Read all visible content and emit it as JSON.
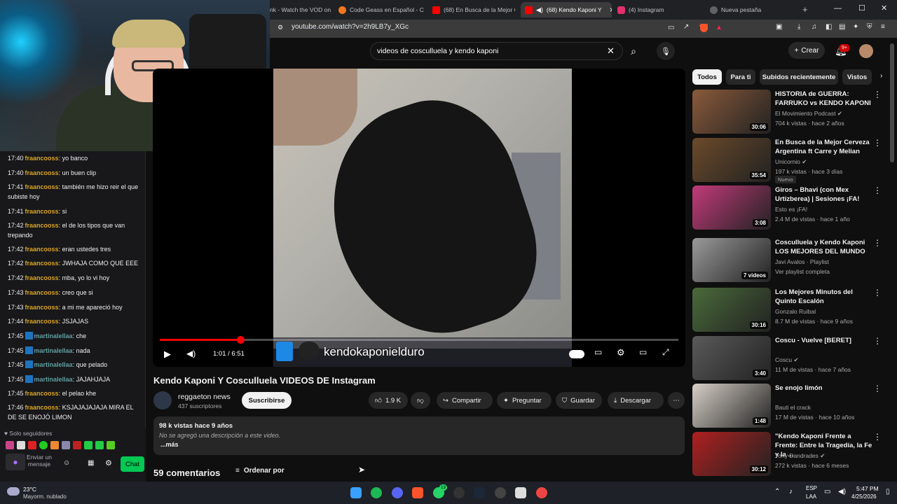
{
  "webcam": {
    "description_icon": "webcam-overlay"
  },
  "chat": {
    "messages": [
      {
        "time": "17:40",
        "user": "fraancooss",
        "text": ": yo banco",
        "kind": "gold"
      },
      {
        "time": "17:40",
        "user": "fraancooss",
        "text": ": un buen clip",
        "kind": "gold"
      },
      {
        "time": "17:41",
        "user": "fraancooss",
        "text": ": también me hizo reir el que subiste hoy",
        "kind": "gold"
      },
      {
        "time": "17:41",
        "user": "fraancooss",
        "text": ": si",
        "kind": "gold"
      },
      {
        "time": "17:42",
        "user": "fraancooss",
        "text": ": el de los tipos que van trepando",
        "kind": "gold"
      },
      {
        "time": "17:42",
        "user": "fraancooss",
        "text": ": eran ustedes tres",
        "kind": "gold"
      },
      {
        "time": "17:42",
        "user": "fraancooss",
        "text": ": JWHAJA COMO QUE EEE",
        "kind": "gold"
      },
      {
        "time": "17:42",
        "user": "fraancooss",
        "text": ": mba, yo lo vi hoy",
        "kind": "gold"
      },
      {
        "time": "17:43",
        "user": "fraancooss",
        "text": ": creo que si",
        "kind": "gold"
      },
      {
        "time": "17:43",
        "user": "fraancooss",
        "text": ": a mi me apareció hoy",
        "kind": "gold"
      },
      {
        "time": "17:44",
        "user": "fraancooss",
        "text": ": JSJAJAS",
        "kind": "gold"
      },
      {
        "time": "17:45",
        "user": "martinalellaa",
        "text": ": che",
        "kind": "teal"
      },
      {
        "time": "17:45",
        "user": "martinalellaa",
        "text": ": nada",
        "kind": "teal"
      },
      {
        "time": "17:45",
        "user": "martinalellaa",
        "text": ": que pelado",
        "kind": "teal"
      },
      {
        "time": "17:45",
        "user": "martinalellaa",
        "text": ": JAJAHJAJA",
        "kind": "teal"
      },
      {
        "time": "17:45",
        "user": "fraancooss",
        "text": ": el pelao khe",
        "kind": "gold"
      },
      {
        "time": "17:46",
        "user": "fraancooss",
        "text": ": KSJAJAJAJAJA MIRA EL DE SE ENOJÓ LIMON",
        "kind": "gold"
      }
    ],
    "followers_only": "Solo seguidores",
    "send_placeholder": "Enviar un mensaje",
    "chat_button": "Chat"
  },
  "browser": {
    "tabs": [
      {
        "label": "nk - Watch the VOD on",
        "color": "#888888"
      },
      {
        "label": "Code Geass en Español - Cr",
        "color": "#f47521"
      },
      {
        "label": "(68) En Busca de la Mejor C",
        "color": "#ff0000"
      },
      {
        "label": "(68) Kendo Kaponi Y",
        "color": "#ff0000"
      },
      {
        "label": "(4) Instagram",
        "color": "#e1306c"
      },
      {
        "label": "Nueva pestaña",
        "color": "#bdc1c6"
      }
    ],
    "url": "youtube.com/watch?v=2h9LB7y_XGc"
  },
  "youtube": {
    "search_query": "videos de cosculluela y kendo kaponi",
    "create_label": "Crear",
    "notif_count": "9+",
    "chips": [
      "Todos",
      "Para ti",
      "Subidos recientemente",
      "Vistos"
    ],
    "player": {
      "overlay_text": "kendokaponielduro",
      "time": "1:01 / 6:51",
      "progress_fraction": 0.156
    },
    "video": {
      "title": "Kendo Kaponi Y Cosculluela VIDEOS DE Instagram",
      "channel": "reggaeton news",
      "subscribers": "437 suscriptores",
      "subscribe": "Suscribirse",
      "likes": "1.9 K",
      "share": "Compartir",
      "ask": "Preguntar",
      "save": "Guardar",
      "download": "Descargar",
      "views_date": "98 k vistas  hace 9 años",
      "desc_empty": "No se agregó una descripción a este video.",
      "more": "...más",
      "comments": "59 comentarios",
      "sort": "Ordenar por"
    },
    "recommendations": [
      {
        "title": "HISTORIA de GUERRA: FARRUKO vs KENDO KAPONI",
        "channel": "El Movimiento Podcast",
        "meta": "704 k vistas · hace 2 años",
        "duration": "30:06",
        "verified": true,
        "color": "#8a5a3a"
      },
      {
        "title": "En Busca de la Mejor Cerveza Argentina ft Carre y Melian",
        "channel": "Unicornio",
        "meta": "197 k vistas · hace 3 días",
        "duration": "35:54",
        "verified": true,
        "nuevo": "Nuevo",
        "color": "#6b4a2a"
      },
      {
        "title": "Giros – Bhavi (con Mex Urtizberea) | Sesiones ¡FA!",
        "channel": "Esto es ¡FA!",
        "meta": "2.4 M de vistas · hace 1 año",
        "duration": "3:08",
        "verified": false,
        "color": "#c23a7a"
      },
      {
        "title": "Cosculluela y Kendo Kaponi LOS MEJORES DEL MUNDO",
        "channel": "Javi Avalos · Playlist",
        "meta": "Ver playlist completa",
        "duration": "7 videos",
        "verified": false,
        "color": "#9a9a9a"
      },
      {
        "title": "Los Mejores Minutos del Quinto Escalón",
        "channel": "Gonzalo Ruibal",
        "meta": "8.7 M de vistas · hace 9 años",
        "duration": "30:16",
        "verified": false,
        "color": "#4a6a3a"
      },
      {
        "title": "Coscu - Vuelve [BERET]",
        "channel": "Coscu",
        "meta": "11 M de vistas · hace 7 años",
        "duration": "3:40",
        "verified": true,
        "color": "#5a5a5a"
      },
      {
        "title": "Se enojo limón",
        "channel": "Bauti el crack",
        "meta": "17 M de vistas · hace 10 años",
        "duration": "1:48",
        "verified": false,
        "color": "#d8d0c8"
      },
      {
        "title": "\"Kendo Kaponi  Frente a Frente: Entre la Tragedia, la Fe y la ...",
        "channel": "Tony Dandrades",
        "meta": "272 k vistas · hace 6 meses",
        "duration": "30:12",
        "verified": true,
        "color": "#b02020"
      }
    ]
  },
  "taskbar": {
    "temp": "23°C",
    "weather": "Mayorm. nublado",
    "lang1": "ESP",
    "lang2": "LAA",
    "time": "5:47 PM",
    "date": "4/25/2026",
    "whatsapp_count": "13"
  }
}
